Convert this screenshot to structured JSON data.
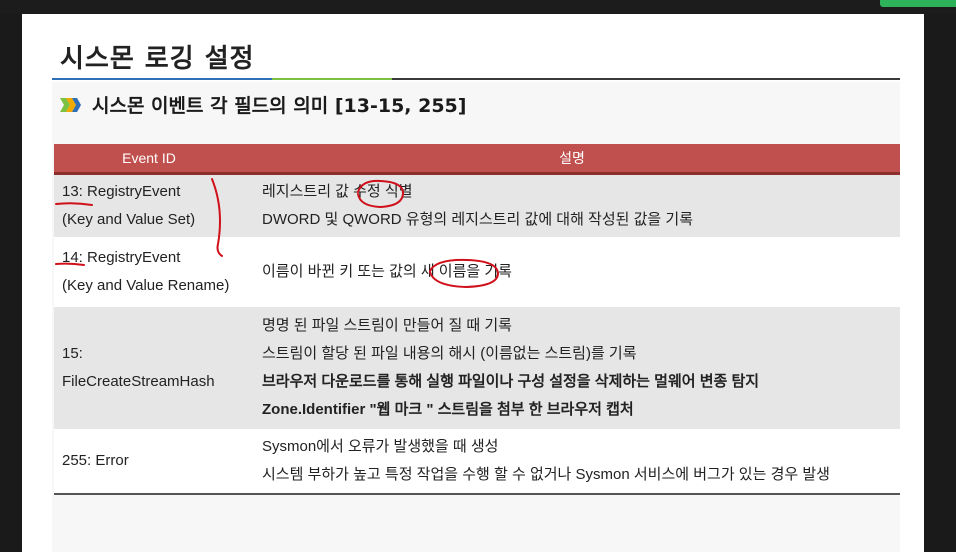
{
  "title": "시스몬 로깅 설정",
  "subtitle": "시스몬 이벤트 각 필드의 의미 [13-15, 255]",
  "table": {
    "headers": [
      "Event ID",
      "설명"
    ],
    "rows": [
      {
        "id_lines": [
          "13: RegistryEvent",
          "(Key and Value Set)"
        ],
        "desc_lines": [
          "레지스트리 값 수정 식별",
          "DWORD 및 QWORD 유형의 레지스트리 값에 대해 작성된 값을 기록"
        ]
      },
      {
        "id_lines": [
          "14: RegistryEvent",
          "(Key and Value Rename)"
        ],
        "desc_lines": [
          "이름이 바뀐 키 또는 값의 새 이름을 기록"
        ]
      },
      {
        "id_lines": [
          "15:",
          "FileCreateStreamHash"
        ],
        "desc_lines": [
          "명명 된 파일 스트림이 만들어 질 때 기록",
          "스트림이 할당 된 파일 내용의 해시 (이름없는 스트림)를 기록",
          "브라우저 다운로드를 통해 실행 파일이나 구성 설정을 삭제하는 멀웨어 변종 탐지",
          "Zone.Identifier \"웹 마크 \"  스트림을 첨부 한 브라우저 캡처"
        ]
      },
      {
        "id_lines": [
          "255: Error"
        ],
        "desc_lines": [
          "Sysmon에서 오류가 발생했을 때 생성",
          "시스템 부하가 높고 특정 작업을 수행 할 수 없거나 Sysmon 서비스에 버그가 있는 경우 발생"
        ]
      }
    ]
  },
  "colors": {
    "header_bg": "#c0504d",
    "row_alt": "#e6e6e6",
    "ink": "#d0101a",
    "accent_blue": "#2e6fb7",
    "accent_green": "#7cc242"
  }
}
